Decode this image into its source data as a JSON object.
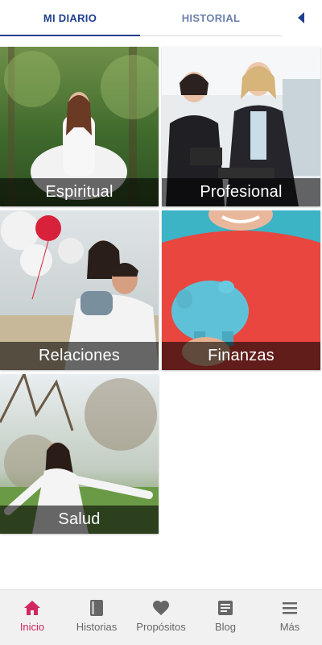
{
  "tabs": {
    "mi_diario": "MI DIARIO",
    "historial": "HISTORIAL"
  },
  "categories": [
    {
      "label": "Espiritual"
    },
    {
      "label": "Profesional"
    },
    {
      "label": "Relaciones"
    },
    {
      "label": "Finanzas"
    },
    {
      "label": "Salud"
    }
  ],
  "bottom_nav": {
    "items": [
      {
        "label": "Inicio",
        "icon": "home-icon",
        "active": true
      },
      {
        "label": "Historias",
        "icon": "book-icon"
      },
      {
        "label": "Propósitos",
        "icon": "heart-icon"
      },
      {
        "label": "Blog",
        "icon": "blog-icon"
      },
      {
        "label": "Más",
        "icon": "menu-icon"
      }
    ]
  },
  "colors": {
    "tab_active": "#1f3f8f",
    "nav_active": "#d0285f",
    "nav_inactive": "#666666"
  }
}
